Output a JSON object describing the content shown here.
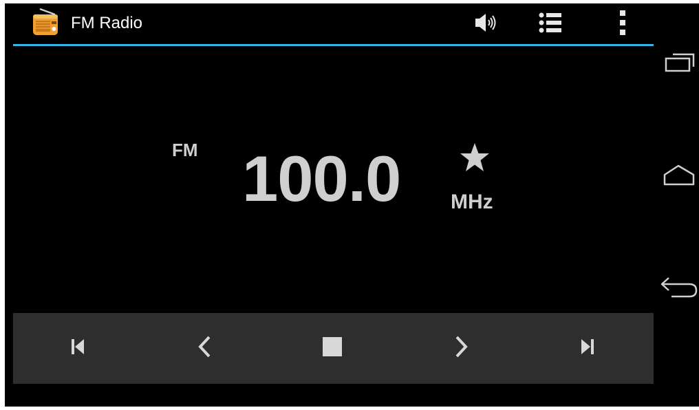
{
  "app": {
    "title": "FM Radio",
    "icon": "radio-icon"
  },
  "action_bar": {
    "actions": [
      {
        "name": "volume",
        "icon": "speaker-icon"
      },
      {
        "name": "station-list",
        "icon": "list-icon"
      },
      {
        "name": "overflow-menu",
        "icon": "more-vert-icon"
      }
    ]
  },
  "tuner": {
    "band": "FM",
    "frequency": "100.0",
    "unit": "MHz",
    "favorite_icon": "star-icon"
  },
  "controls": [
    {
      "name": "previous-station",
      "icon": "skip-previous-icon"
    },
    {
      "name": "seek-down",
      "icon": "chevron-left-icon"
    },
    {
      "name": "stop",
      "icon": "stop-icon"
    },
    {
      "name": "seek-up",
      "icon": "chevron-right-icon"
    },
    {
      "name": "next-station",
      "icon": "skip-next-icon"
    }
  ],
  "navigation": [
    {
      "name": "recents",
      "icon": "recents-icon"
    },
    {
      "name": "home",
      "icon": "home-icon"
    },
    {
      "name": "back",
      "icon": "back-icon"
    }
  ],
  "colors": {
    "background": "#000000",
    "accent": "#33b5e5",
    "text_primary": "#ffffff",
    "text_display": "#cfcfcf",
    "control_bar": "#2e2e2e",
    "icon": "#d8d8d8",
    "app_icon": "#f0a030"
  }
}
